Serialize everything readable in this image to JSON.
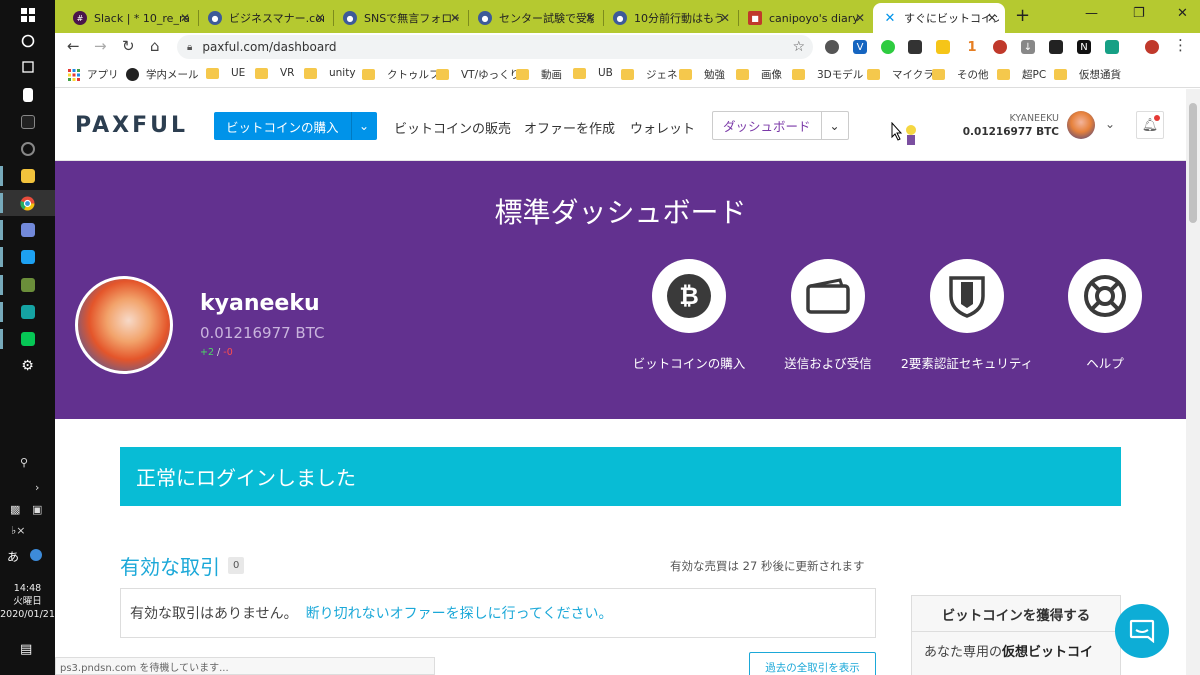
{
  "taskbar": {
    "time": "14:48",
    "day": "火曜日",
    "date": "2020/01/21",
    "ime": "あ"
  },
  "tabs": [
    {
      "title": "Slack | * 10_re_ra",
      "icon": "slack-icon",
      "color": "#4a154b"
    },
    {
      "title": "ビジネスマナー.com",
      "icon": "hatena-icon",
      "color": "#3d5a99"
    },
    {
      "title": "SNSで無言フォロー",
      "icon": "hatena-icon",
      "color": "#3d5a99"
    },
    {
      "title": "センター試験で受験",
      "icon": "hatena-icon",
      "color": "#3d5a99"
    },
    {
      "title": "10分前行動はもう",
      "icon": "hatena-icon",
      "color": "#3d5a99"
    },
    {
      "title": "canipoyo's diary",
      "icon": "diary-icon",
      "color": "#c0392b"
    },
    {
      "title": "すぐにビットコインを",
      "icon": "paxful-icon",
      "color": "#0093e9"
    }
  ],
  "address": {
    "url": "paxful.com/dashboard"
  },
  "extensions": {
    "count_badge": "1"
  },
  "bookmarks": [
    {
      "label": "アプリ",
      "type": "apps"
    },
    {
      "label": "学内メール",
      "type": "globe"
    },
    {
      "label": "UE",
      "type": "folder"
    },
    {
      "label": "VR",
      "type": "folder"
    },
    {
      "label": "unity",
      "type": "folder"
    },
    {
      "label": "クトゥルフ",
      "type": "folder"
    },
    {
      "label": "VT/ゆっくり",
      "type": "folder"
    },
    {
      "label": "動画",
      "type": "folder"
    },
    {
      "label": "UB",
      "type": "folder"
    },
    {
      "label": "ジェネ",
      "type": "folder"
    },
    {
      "label": "勉強",
      "type": "folder"
    },
    {
      "label": "画像",
      "type": "folder"
    },
    {
      "label": "3Dモデル",
      "type": "folder"
    },
    {
      "label": "マイクラ",
      "type": "folder"
    },
    {
      "label": "その他",
      "type": "folder"
    },
    {
      "label": "超PC",
      "type": "folder"
    },
    {
      "label": "仮想通貨",
      "type": "folder"
    }
  ],
  "header": {
    "logo": "PAXFUL",
    "buy": "ビットコインの購入",
    "sell": "ビットコインの販売",
    "create_offer": "オファーを作成",
    "wallet": "ウォレット",
    "dashboard": "ダッシュボード",
    "username": "KYANEEKU",
    "balance": "0.01216977 BTC"
  },
  "band": {
    "title": "標準ダッシュボード",
    "name": "kyaneeku",
    "btc": "0.01216977 BTC",
    "feedback_pos": "+2",
    "feedback_sep": " / ",
    "feedback_neg": "-0",
    "actions": [
      {
        "label": "ビットコインの購入",
        "icon": "bitcoin-icon"
      },
      {
        "label": "送信および受信",
        "icon": "wallet-icon"
      },
      {
        "label": "2要素認証セキュリティ",
        "icon": "shield-icon"
      },
      {
        "label": "ヘルプ",
        "icon": "lifebuoy-icon"
      }
    ]
  },
  "content": {
    "success": "正常にログインしました",
    "trades_title": "有効な取引",
    "trades_count": "0",
    "trades_update": "有効な売買は 27 秒後に更新されます",
    "empty_text": "有効な取引はありません。",
    "empty_link": "断り切れないオファーを探しに行ってください。",
    "past_button": "過去の全取引を表示",
    "side_title": "ビットコインを獲得する",
    "side_text_1": "あなた専用の",
    "side_text_bold": "仮想ビットコイ",
    "status": "ps3.pndsn.com を待機しています..."
  },
  "colors": {
    "brand_purple": "#62318f",
    "primary_blue": "#0093e9",
    "success_cyan": "#08bcd5",
    "link_blue": "#1ba8d8",
    "tabstrip": "#b5c930"
  }
}
